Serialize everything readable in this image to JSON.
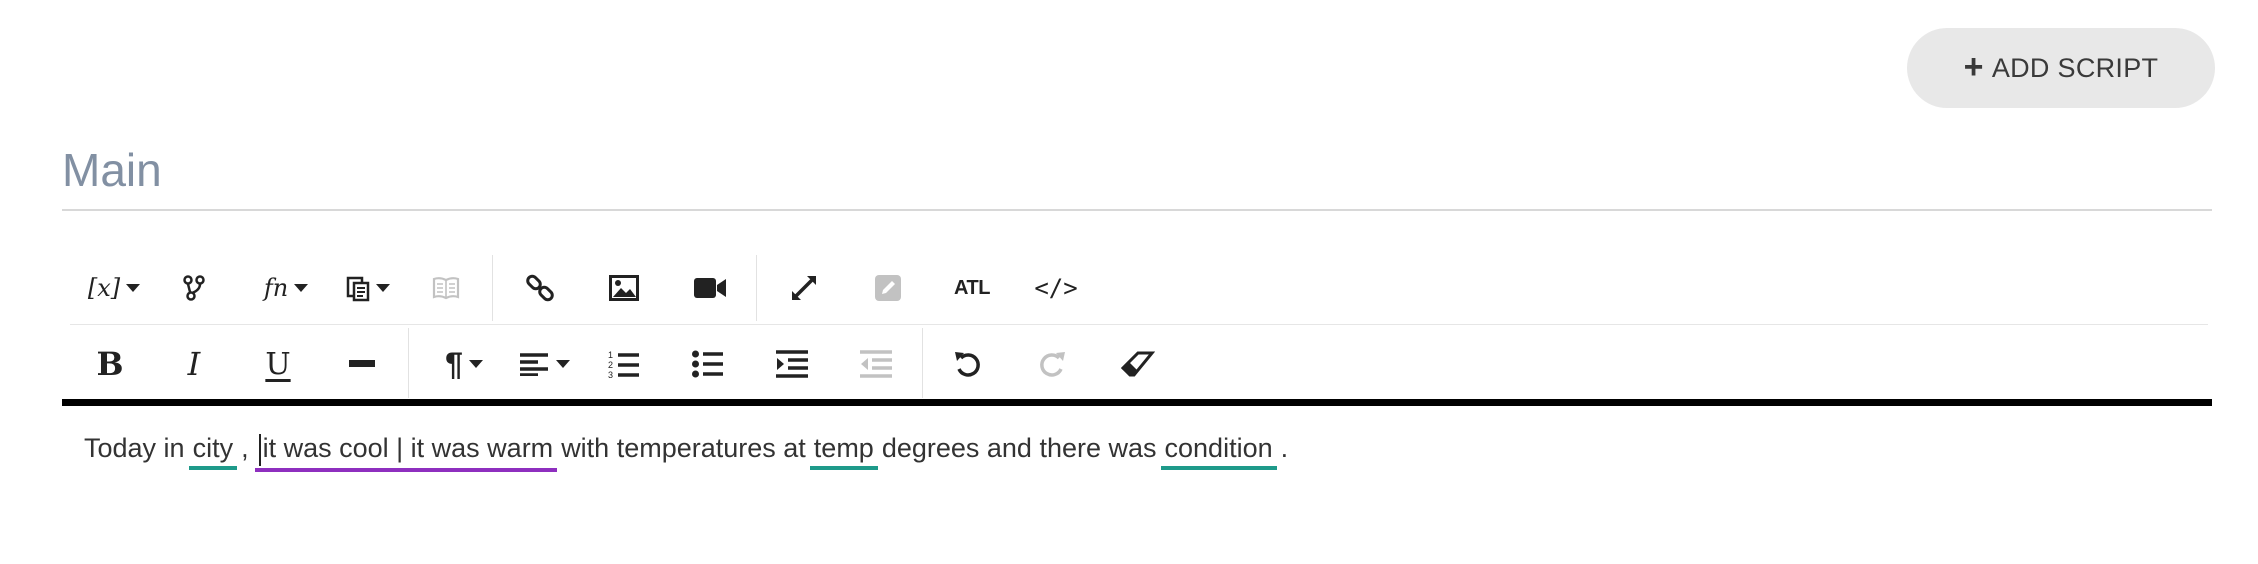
{
  "header": {
    "add_script_label": "ADD SCRIPT"
  },
  "section": {
    "title": "Main"
  },
  "toolbar": {
    "row1": [
      {
        "name": "variable-dropdown-button",
        "icon": "variable-icon",
        "label": "[x]"
      },
      {
        "name": "branch-button",
        "icon": "branch-icon"
      },
      {
        "name": "function-dropdown-button",
        "icon": "function-icon",
        "label": "fn"
      },
      {
        "name": "paste-dropdown-button",
        "icon": "clipboard-icon"
      },
      {
        "name": "book-button",
        "icon": "book-icon",
        "disabled": true
      },
      {
        "name": "link-button",
        "icon": "link-icon"
      },
      {
        "name": "image-button",
        "icon": "image-icon"
      },
      {
        "name": "video-button",
        "icon": "video-icon"
      },
      {
        "name": "fullscreen-button",
        "icon": "expand-icon"
      },
      {
        "name": "edit-button",
        "icon": "pencil-icon",
        "disabled": true
      },
      {
        "name": "atl-button",
        "label": "ATL"
      },
      {
        "name": "code-view-button",
        "icon": "code-icon",
        "label": "</>"
      }
    ],
    "row2": [
      {
        "name": "bold-button",
        "icon": "bold-icon",
        "label": "B"
      },
      {
        "name": "italic-button",
        "icon": "italic-icon",
        "label": "I"
      },
      {
        "name": "underline-button",
        "icon": "underline-icon",
        "label": "U"
      },
      {
        "name": "horizontal-rule-button",
        "icon": "horizontal-rule-icon"
      },
      {
        "name": "paragraph-dropdown-button",
        "icon": "paragraph-icon",
        "label": "¶"
      },
      {
        "name": "align-dropdown-button",
        "icon": "align-left-icon"
      },
      {
        "name": "ordered-list-button",
        "icon": "ordered-list-icon"
      },
      {
        "name": "unordered-list-button",
        "icon": "unordered-list-icon"
      },
      {
        "name": "indent-button",
        "icon": "indent-icon"
      },
      {
        "name": "outdent-button",
        "icon": "outdent-icon",
        "disabled": true
      },
      {
        "name": "undo-button",
        "icon": "undo-icon"
      },
      {
        "name": "redo-button",
        "icon": "redo-icon",
        "disabled": true
      },
      {
        "name": "clear-format-button",
        "icon": "eraser-icon"
      }
    ]
  },
  "editor": {
    "text_before_city": "Today in",
    "token_city": "city",
    "comma": ",",
    "token_alternation": "it was cool | it was warm",
    "text_mid": "with temperatures at",
    "token_temp": "temp",
    "text_after_temp": "degrees and there was",
    "token_condition": "condition",
    "period": "."
  },
  "colors": {
    "token_variable": "#1e9a8a",
    "token_alternation": "#8e2fbf",
    "title": "#8290a3",
    "editor_border": "#000000"
  }
}
